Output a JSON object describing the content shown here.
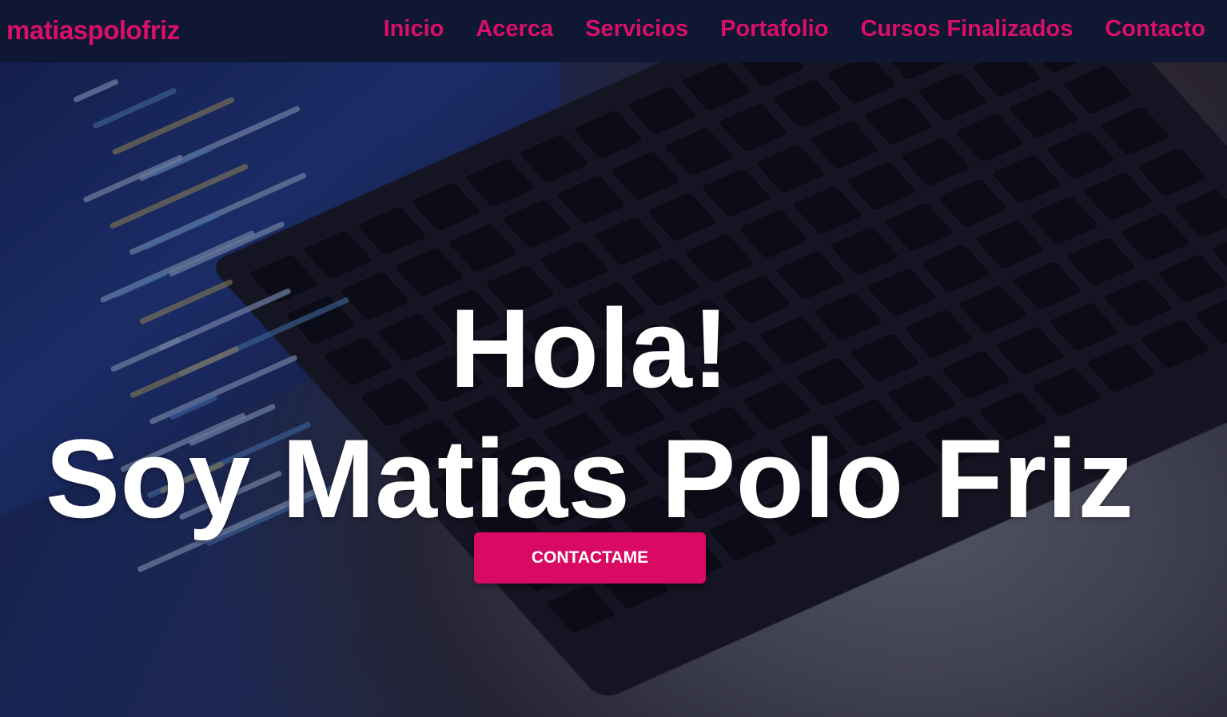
{
  "header": {
    "brand": "matiaspolofriz",
    "nav": [
      {
        "label": "Inicio"
      },
      {
        "label": "Acerca"
      },
      {
        "label": "Servicios"
      },
      {
        "label": "Portafolio"
      },
      {
        "label": "Cursos Finalizados"
      },
      {
        "label": "Contacto"
      }
    ]
  },
  "hero": {
    "line1": "Hola!",
    "line2": "Soy Matias Polo Friz",
    "cta_label": "CONTACTAME"
  },
  "colors": {
    "accent": "#d90f6a",
    "navbar_bg": "#0f1733",
    "text": "#ffffff"
  }
}
